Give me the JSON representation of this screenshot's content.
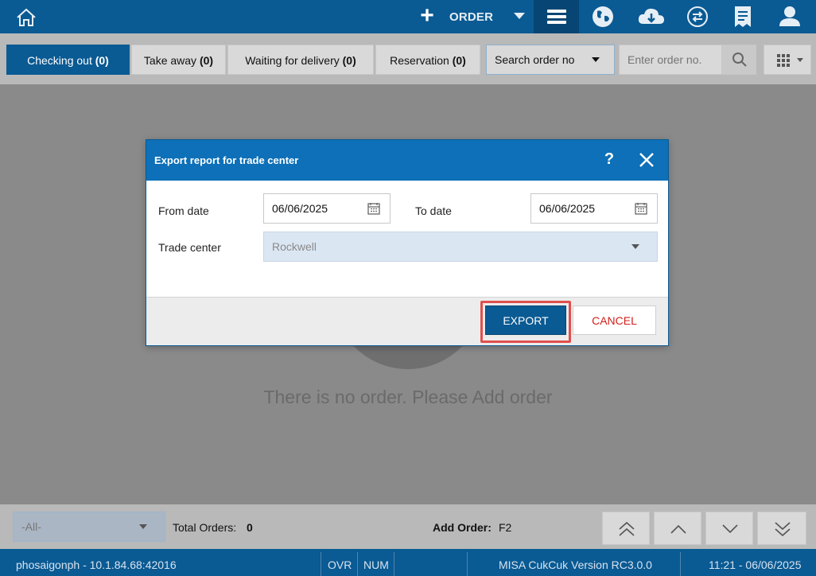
{
  "topbar": {
    "order_label": "ORDER",
    "icons": [
      "home-icon",
      "plus-icon",
      "menu-icon",
      "globe-icon",
      "cloud-download-icon",
      "sync-icon",
      "receipt-icon",
      "user-icon"
    ],
    "bg_color": "#0a5a93"
  },
  "tabs": [
    {
      "label": "Checking out",
      "count": "(0)",
      "active": true
    },
    {
      "label": "Take away",
      "count": "(0)",
      "active": false
    },
    {
      "label": "Waiting for delivery",
      "count": "(0)",
      "active": false
    },
    {
      "label": "Reservation",
      "count": "(0)",
      "active": false
    }
  ],
  "search": {
    "select_value": "Search order no",
    "input_placeholder": "Enter order no."
  },
  "main": {
    "empty_message": "There is no order. Please Add order"
  },
  "dialog": {
    "title": "Export report for trade center",
    "help_label": "?",
    "from_date_label": "From date",
    "from_date_value": "06/06/2025",
    "to_date_label": "To date",
    "to_date_value": "06/06/2025",
    "trade_center_label": "Trade center",
    "trade_center_value": "Rockwell",
    "export_label": "EXPORT",
    "cancel_label": "CANCEL"
  },
  "bottombar": {
    "filter_value": "-All-",
    "total_orders_label": "Total Orders:",
    "total_orders_value": "0",
    "add_order_label": "Add Order:",
    "add_order_shortcut": "F2"
  },
  "statusbar": {
    "host": "phosaigonph - 10.1.84.68:42016",
    "ovr": "OVR",
    "num": "NUM",
    "version": "MISA CukCuk Version RC3.0.0",
    "datetime": "11:21 - 06/06/2025"
  },
  "colors": {
    "primary": "#0a5a93",
    "dialog_header": "#0d70b8",
    "highlight": "#e0504d",
    "cancel_text": "#d0211c"
  }
}
